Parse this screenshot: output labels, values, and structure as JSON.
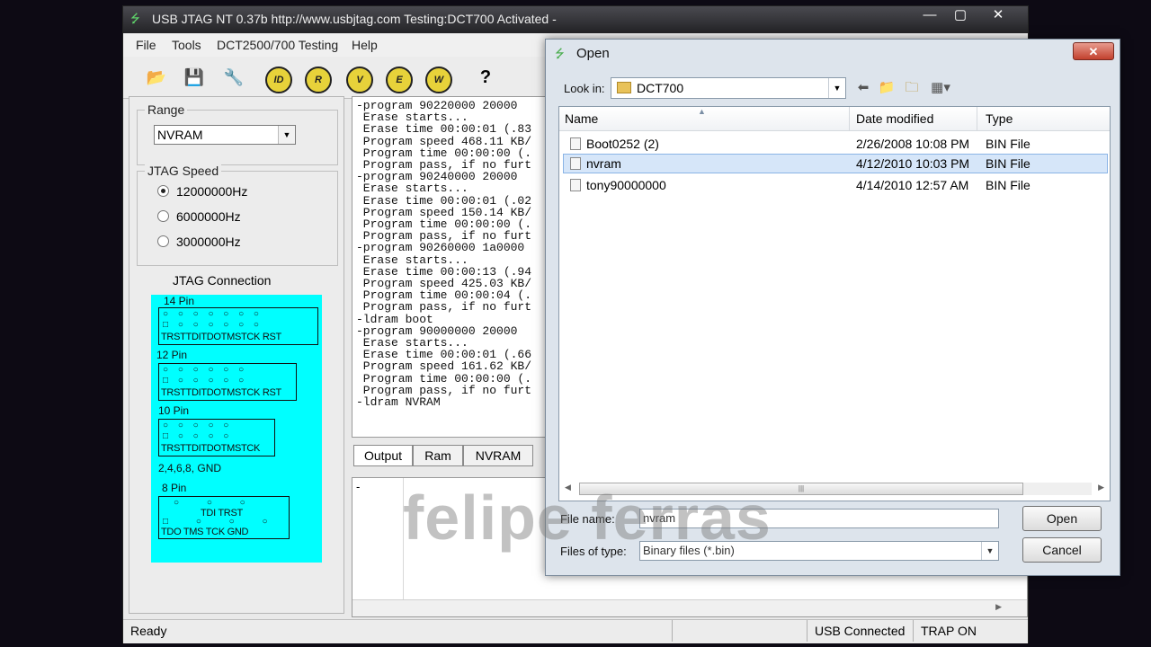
{
  "main_window": {
    "title": "USB JTAG NT  0.37b http://www.usbjtag.com  Testing:DCT700  Activated -",
    "controls": {
      "minimize": "—",
      "maximize": "▢",
      "close": "✕"
    }
  },
  "menu": [
    "File",
    "Tools",
    "DCT2500/700 Testing",
    "Help"
  ],
  "toolbar": {
    "icons": [
      "open-folder-icon",
      "save-disk-icon",
      "wrench-icon",
      "id-chip-icon",
      "read-chip-icon",
      "verify-chip-icon",
      "erase-chip-icon",
      "write-chip-icon",
      "help-icon"
    ],
    "labels": {
      "id": "ID",
      "read": "R",
      "verify": "V",
      "erase": "E",
      "write": "W",
      "help": "?"
    }
  },
  "range": {
    "legend": "Range",
    "selected": "NVRAM"
  },
  "jtag_speed": {
    "legend": "JTAG Speed",
    "options": [
      "12000000Hz",
      "6000000Hz",
      "3000000Hz"
    ],
    "selected_index": 0
  },
  "jtag_connection": {
    "title": "JTAG Connection",
    "pin14": {
      "label": "14 Pin",
      "signals": "TRSTTDITDOTMSTCK RST"
    },
    "pin12": {
      "label": "12 Pin",
      "signals": "TRSTTDITDOTMSTCK RST"
    },
    "pin10": {
      "label": "10 Pin",
      "signals": "TRSTTDITDOTMSTCK"
    },
    "gnd_note": "2,4,6,8, GND",
    "pin8": {
      "label": "8  Pin",
      "row1": "TDI  TRST",
      "row2": "TDO  TMS  TCK  GND"
    }
  },
  "log_lines": [
    "-program 90220000 20000",
    " Erase starts...",
    " Erase time 00:00:01 (.83",
    " Program speed 468.11 KB/",
    " Program time 00:00:00 (.",
    " Program pass, if no furt",
    "-program 90240000 20000",
    " Erase starts...",
    " Erase time 00:00:01 (.02",
    " Program speed 150.14 KB/",
    " Program time 00:00:00 (.",
    " Program pass, if no furt",
    "-program 90260000 1a0000",
    " Erase starts...",
    " Erase time 00:00:13 (.94",
    " Program speed 425.03 KB/",
    " Program time 00:00:04 (.",
    " Program pass, if no furt",
    "-ldram boot",
    "-program 90000000 20000",
    " Erase starts...",
    " Erase time 00:00:01 (.66",
    " Program speed 161.62 KB/",
    " Program time 00:00:00 (.",
    " Program pass, if no furt",
    "-ldram NVRAM"
  ],
  "tabs": [
    "Output",
    "Ram",
    "NVRAM"
  ],
  "output_text": "-",
  "status": {
    "left": "Ready",
    "usb": "USB Connected",
    "trap": "TRAP ON"
  },
  "dialog": {
    "title": "Open",
    "close": "✕",
    "look_in_label": "Look in:",
    "look_in_value": "DCT700",
    "columns": {
      "name": "Name",
      "date": "Date modified",
      "type": "Type"
    },
    "files": [
      {
        "name": "Boot0252 (2)",
        "date": "2/26/2008 10:08 PM",
        "type": "BIN File"
      },
      {
        "name": "nvram",
        "date": "4/12/2010 10:03 PM",
        "type": "BIN File"
      },
      {
        "name": "tony90000000",
        "date": "4/14/2010 12:57 AM",
        "type": "BIN File"
      }
    ],
    "selected_file_index": 1,
    "file_name_label": "File name:",
    "file_name_value": "nvram",
    "file_type_label": "Files of type:",
    "file_type_value": "Binary files (*.bin)",
    "open_button": "Open",
    "cancel_button": "Cancel"
  },
  "watermark": "felipe ferras",
  "colors": {
    "jtag_panel": "#00ffff",
    "selection": "#d6e6f9",
    "close_red": "#c2412d"
  }
}
